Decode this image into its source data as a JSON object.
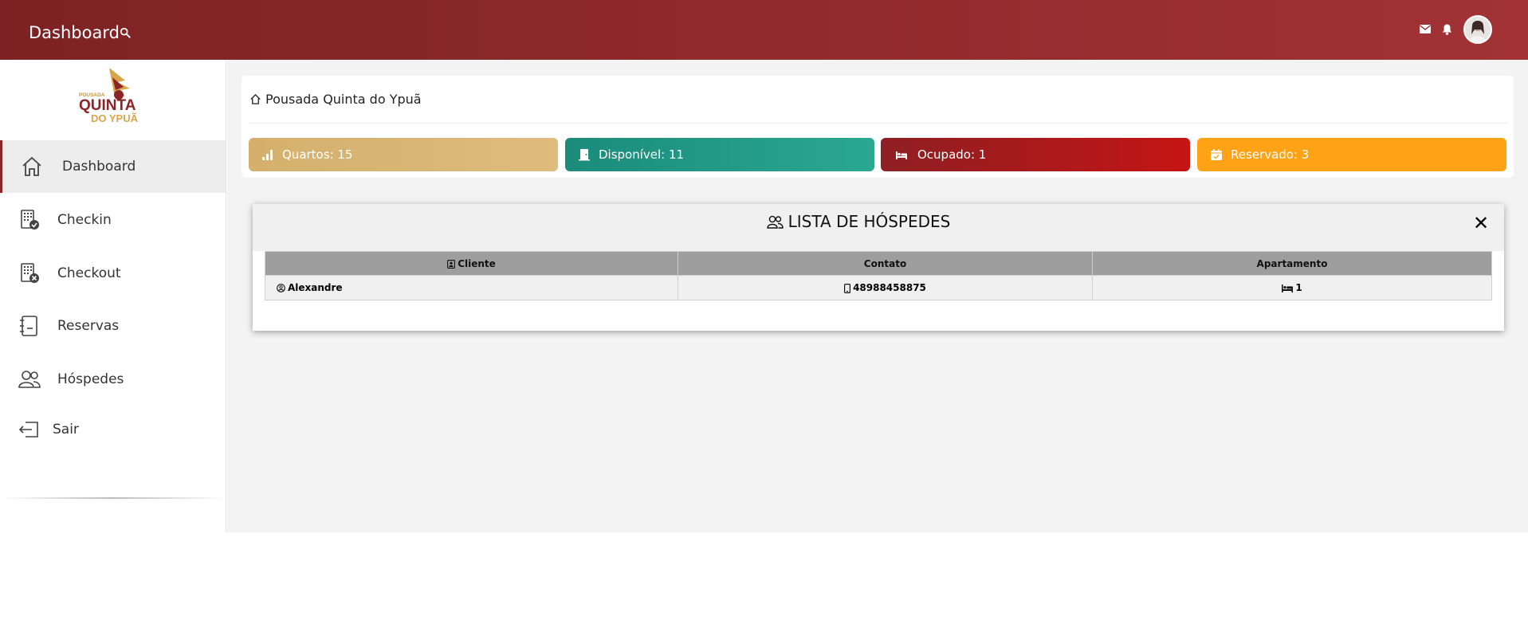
{
  "header": {
    "title": "Dashboard",
    "icons": [
      "search-icon",
      "mail-icon",
      "bell-icon",
      "avatar"
    ]
  },
  "sidebar": {
    "logo": {
      "line1": "POUSADA",
      "line2": "QUINTA",
      "line3": "DO YPUÃ"
    },
    "items": [
      {
        "label": "Dashboard",
        "icon": "home-icon",
        "active": true
      },
      {
        "label": "Checkin",
        "icon": "building-check-icon"
      },
      {
        "label": "Checkout",
        "icon": "building-x-icon"
      },
      {
        "label": "Reservas",
        "icon": "journal-icon"
      },
      {
        "label": "Hóspedes",
        "icon": "people-icon"
      },
      {
        "label": "Sair",
        "icon": "logout-icon"
      }
    ]
  },
  "main": {
    "breadcrumb": "Pousada Quinta do Ypuã",
    "stats": [
      {
        "label": "Quartos: 15",
        "color": "#dbb777",
        "icon": "bar-chart-icon"
      },
      {
        "label": "Disponível: 11",
        "color": "#22998a",
        "icon": "door-icon"
      },
      {
        "label": "Ocupado: 1",
        "color": "#a11b1b",
        "icon": "bed-icon"
      },
      {
        "label": "Reservado: 3",
        "color": "#ffa216",
        "icon": "calendar-check-icon"
      }
    ]
  },
  "modal": {
    "title": "LISTA DE HÓSPEDES",
    "close": "✕",
    "table": {
      "headers": [
        "Cliente",
        "Contato",
        "Apartamento"
      ],
      "rows": [
        {
          "cliente": "Alexandre",
          "contato": "48988458875",
          "apartamento": "1"
        }
      ]
    }
  },
  "colors": {
    "brand": "#8b2426",
    "header_start": "#7d2224",
    "header_end": "#a23235"
  }
}
